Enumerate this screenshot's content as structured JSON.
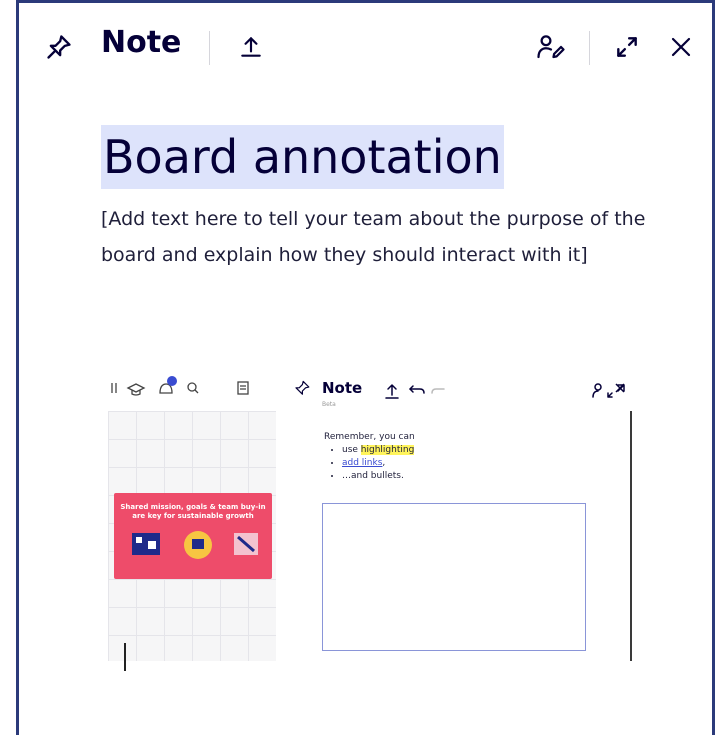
{
  "header": {
    "title": "Note",
    "icons": [
      "pin-icon",
      "upload-icon",
      "collaborators-edit-icon",
      "expand-icon",
      "close-icon"
    ]
  },
  "content": {
    "heading": "Board annotation",
    "paragraph": "[Add text here to tell your team about the purpose of the board and explain how they should interact with it]"
  },
  "embedded_screenshot": {
    "card_text": "Shared mission, goals & team buy-in are key for sustainable growth",
    "note_title": "Note",
    "note_badge": "Beta",
    "intro": "Remember, you can",
    "bullets": [
      {
        "prefix": "use ",
        "highlight": "highlighting"
      },
      {
        "link": "add links",
        "suffix": ","
      },
      {
        "text": "…and bullets."
      }
    ]
  },
  "colors": {
    "text": "#050038",
    "heading_highlight": "#dde3fb",
    "frame": "#2b3a7a",
    "card": "#ee4c6a",
    "highlight": "#fff45c",
    "link": "#3a4cd1"
  }
}
